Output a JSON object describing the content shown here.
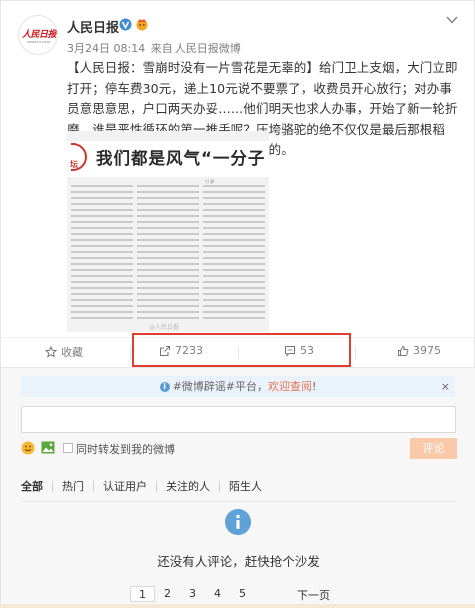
{
  "post": {
    "author": "人民日报",
    "time": "3月24日 08:14",
    "source_prefix": "来自",
    "source": "人民日报微博",
    "text": "【人民日报：雪崩时没有一片雪花是无辜的】给门卫上支烟，大门立即打开；停车费30元，递上10元说不要票了，收费员开心放行；对办事员意思意思，户口两天办妥……他们明天也求人办事，开始了新一轮折磨。谁是恶性循环的第一推手呢？压垮骆驼的绝不仅仅是最后那根稻草，雪崩的时候没有一片雪花是无辜的。",
    "image_headline": "我们都是风气“一分子",
    "image_byline": "付 静",
    "image_stamp": "坛",
    "image_watermark": "@人民日报"
  },
  "actions": {
    "favorite": "收藏",
    "repost_count": "7233",
    "comment_count": "53",
    "like_count": "3975"
  },
  "comment": {
    "notice_tag": "#微博辟谣#平台",
    "notice_sep": "，",
    "notice_link": "欢迎查阅",
    "notice_end": "!",
    "close": "×",
    "repost_label": "同时转发到我的微博",
    "submit": "评论",
    "tabs": [
      "全部",
      "热门",
      "认证用户",
      "关注的人",
      "陌生人"
    ],
    "empty": "还没有人评论，赶快抢个沙发",
    "pages": [
      "1",
      "2",
      "3",
      "4",
      "5"
    ],
    "next": "下一页"
  },
  "colors": {
    "accent": "#eb7350",
    "highlight_box": "#e03c2f",
    "brand_red": "#d0141b"
  }
}
